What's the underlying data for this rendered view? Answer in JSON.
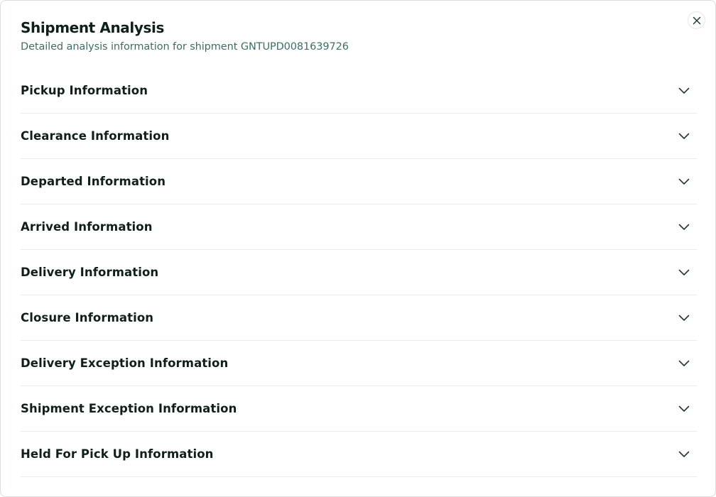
{
  "dialog": {
    "title": "Shipment Analysis",
    "subtitle": "Detailed analysis information for shipment GNTUPD0081639726",
    "close_icon": "close-icon"
  },
  "sections": [
    {
      "label": "Pickup Information",
      "icon": "chevron-down-icon",
      "expanded": false
    },
    {
      "label": "Clearance Information",
      "icon": "chevron-down-icon",
      "expanded": false
    },
    {
      "label": "Departed Information",
      "icon": "chevron-down-icon",
      "expanded": false
    },
    {
      "label": "Arrived Information",
      "icon": "chevron-down-icon",
      "expanded": false
    },
    {
      "label": "Delivery Information",
      "icon": "chevron-down-icon",
      "expanded": false
    },
    {
      "label": "Closure Information",
      "icon": "chevron-down-icon",
      "expanded": false
    },
    {
      "label": "Delivery Exception Information",
      "icon": "chevron-down-icon",
      "expanded": false
    },
    {
      "label": "Shipment Exception Information",
      "icon": "chevron-down-icon",
      "expanded": false
    },
    {
      "label": "Held For Pick Up Information",
      "icon": "chevron-down-icon",
      "expanded": false
    }
  ],
  "colors": {
    "title": "#0f1f1a",
    "subtitle": "#3e6d66",
    "divider": "#e8ecea",
    "icon": "#1f3a33"
  }
}
